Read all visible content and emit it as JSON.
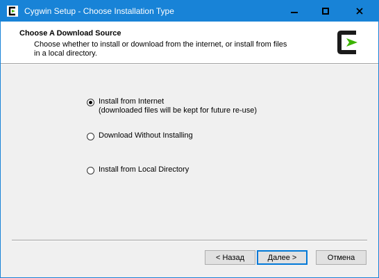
{
  "window": {
    "title": "Cygwin Setup - Choose Installation Type",
    "controls": {
      "minimize": "minimize",
      "maximize": "maximize",
      "close": "close"
    }
  },
  "header": {
    "title": "Choose A Download Source",
    "subtitle": "Choose whether to install or download from the internet, or install from files in a local directory.",
    "logo_icon": "cygwin-logo-icon"
  },
  "options": [
    {
      "label": "Install from Internet",
      "sublabel": "(downloaded files will be kept for future re-use)",
      "checked": true
    },
    {
      "label": "Download Without Installing",
      "checked": false
    },
    {
      "label": "Install from Local Directory",
      "checked": false
    }
  ],
  "buttons": {
    "back": "< Назад",
    "next": "Далее >",
    "cancel": "Отмена"
  },
  "colors": {
    "titlebar": "#1883d7",
    "header_bg": "#ffffff",
    "body_bg": "#f0f0f0",
    "logo_green": "#3bb300"
  }
}
